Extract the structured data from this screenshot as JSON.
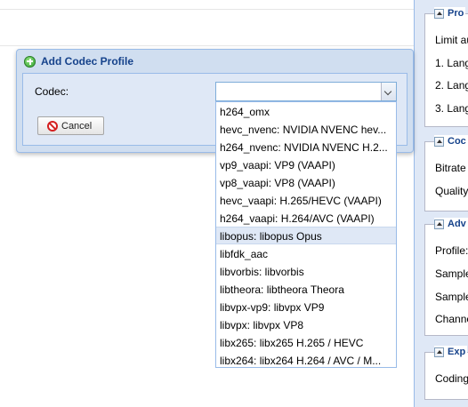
{
  "side_panel": {
    "sections": [
      {
        "title": "Pro",
        "lines": [
          "Limit au",
          "1. Lang",
          "2. Lang",
          "3. Lang"
        ]
      },
      {
        "title": "Coc",
        "lines": [
          "Bitrate",
          "Quality"
        ]
      },
      {
        "title": "Adv",
        "lines": [
          "Profile:",
          "Sample",
          "Sample",
          "Channe"
        ]
      },
      {
        "title": "Exp",
        "lines": [
          "Coding"
        ]
      }
    ]
  },
  "dialog": {
    "title": "Add Codec Profile",
    "codec_label": "Codec:",
    "codec_value": "",
    "cancel_label": "Cancel"
  },
  "dropdown": {
    "selected_index": 8,
    "items": [
      "h264_omx",
      "hevc_nvenc: NVIDIA NVENC hev...",
      "h264_nvenc: NVIDIA NVENC H.2...",
      "vp9_vaapi: VP9 (VAAPI)",
      "vp8_vaapi: VP8 (VAAPI)",
      "hevc_vaapi: H.265/HEVC (VAAPI)",
      "h264_vaapi: H.264/AVC (VAAPI)",
      "libopus: libopus Opus",
      "libfdk_aac",
      "libvorbis: libvorbis",
      "libtheora: libtheora Theora",
      "libvpx-vp9: libvpx VP9",
      "libvpx: libvpx VP8",
      "libx265: libx265 H.265 / HEVC",
      "libx264: libx264 H.264 / AVC / M..."
    ]
  }
}
